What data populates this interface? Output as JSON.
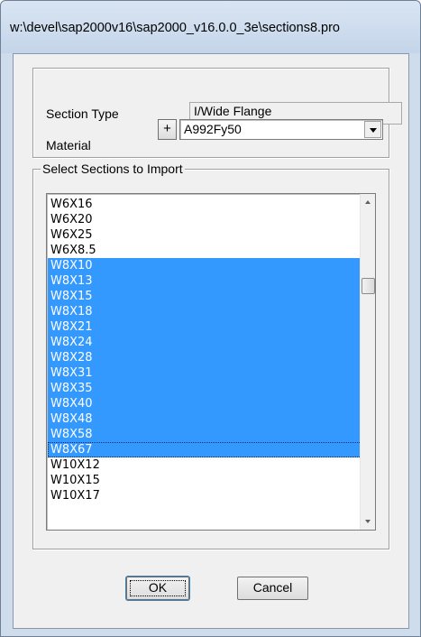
{
  "window": {
    "title": "w:\\devel\\sap2000v16\\sap2000_v16.0.0_3e\\sections8.pro"
  },
  "section_type": {
    "label": "Section Type",
    "value": "I/Wide Flange"
  },
  "material": {
    "label": "Material",
    "add_label": "+",
    "value": "A992Fy50"
  },
  "import_group": {
    "legend": "Select Sections to Import"
  },
  "sections_list": {
    "items": [
      {
        "label": "W6X16",
        "selected": false
      },
      {
        "label": "W6X20",
        "selected": false
      },
      {
        "label": "W6X25",
        "selected": false
      },
      {
        "label": "W6X8.5",
        "selected": false
      },
      {
        "label": "W8X10",
        "selected": true
      },
      {
        "label": "W8X13",
        "selected": true
      },
      {
        "label": "W8X15",
        "selected": true
      },
      {
        "label": "W8X18",
        "selected": true
      },
      {
        "label": "W8X21",
        "selected": true
      },
      {
        "label": "W8X24",
        "selected": true
      },
      {
        "label": "W8X28",
        "selected": true
      },
      {
        "label": "W8X31",
        "selected": true
      },
      {
        "label": "W8X35",
        "selected": true
      },
      {
        "label": "W8X40",
        "selected": true
      },
      {
        "label": "W8X48",
        "selected": true
      },
      {
        "label": "W8X58",
        "selected": true
      },
      {
        "label": "W8X67",
        "selected": true,
        "focused": true
      },
      {
        "label": "W10X12",
        "selected": false
      },
      {
        "label": "W10X15",
        "selected": false
      },
      {
        "label": "W10X17",
        "selected": false
      }
    ]
  },
  "buttons": {
    "ok": "OK",
    "cancel": "Cancel"
  },
  "colors": {
    "selection": "#3399ff",
    "frame": "#cfdcec"
  }
}
